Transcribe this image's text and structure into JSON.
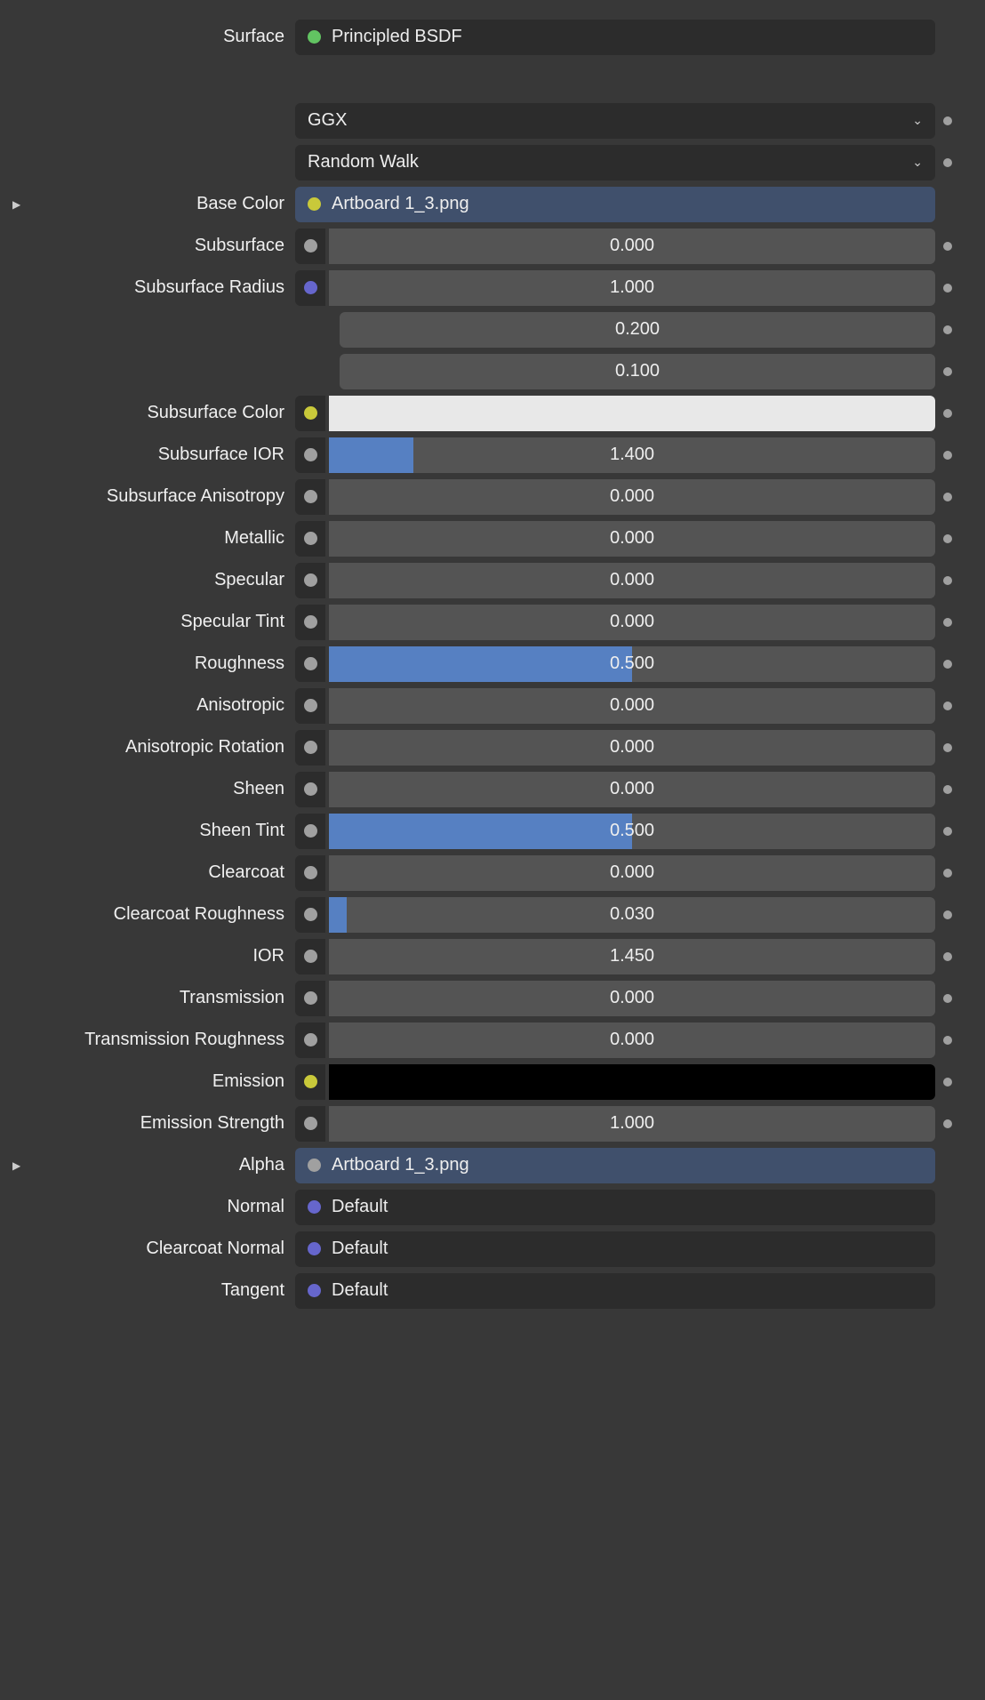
{
  "surface_label": "Surface",
  "surface_value": "Principled BSDF",
  "distribution": "GGX",
  "sss_method": "Random Walk",
  "rows": [
    {
      "label": "Base Color",
      "type": "linked",
      "socket": "yellow",
      "value": "Artboard 1_3.png",
      "expand": true
    },
    {
      "label": "Subsurface",
      "type": "slider",
      "socket": "grey",
      "value": "0.000",
      "fill": 0,
      "anim": true
    },
    {
      "label": "Subsurface Radius",
      "type": "slider",
      "socket": "purple",
      "value": "1.000",
      "fill": 0,
      "anim": true,
      "noconn": false
    },
    {
      "label": "",
      "type": "slider",
      "socket": null,
      "value": "0.200",
      "fill": 0,
      "anim": true,
      "noconn": true
    },
    {
      "label": "",
      "type": "slider",
      "socket": null,
      "value": "0.100",
      "fill": 0,
      "anim": true,
      "noconn": true
    },
    {
      "label": "Subsurface Color",
      "type": "color",
      "socket": "yellow",
      "swatch": "white",
      "anim": true
    },
    {
      "label": "Subsurface IOR",
      "type": "slider",
      "socket": "grey",
      "value": "1.400",
      "fill": 0.14,
      "anim": true
    },
    {
      "label": "Subsurface Anisotropy",
      "type": "slider",
      "socket": "grey",
      "value": "0.000",
      "fill": 0,
      "anim": true
    },
    {
      "label": "Metallic",
      "type": "slider",
      "socket": "grey",
      "value": "0.000",
      "fill": 0,
      "anim": true
    },
    {
      "label": "Specular",
      "type": "slider",
      "socket": "grey",
      "value": "0.000",
      "fill": 0,
      "anim": true
    },
    {
      "label": "Specular Tint",
      "type": "slider",
      "socket": "grey",
      "value": "0.000",
      "fill": 0,
      "anim": true
    },
    {
      "label": "Roughness",
      "type": "slider",
      "socket": "grey",
      "value": "0.500",
      "fill": 0.5,
      "anim": true
    },
    {
      "label": "Anisotropic",
      "type": "slider",
      "socket": "grey",
      "value": "0.000",
      "fill": 0,
      "anim": true
    },
    {
      "label": "Anisotropic Rotation",
      "type": "slider",
      "socket": "grey",
      "value": "0.000",
      "fill": 0,
      "anim": true
    },
    {
      "label": "Sheen",
      "type": "slider",
      "socket": "grey",
      "value": "0.000",
      "fill": 0,
      "anim": true
    },
    {
      "label": "Sheen Tint",
      "type": "slider",
      "socket": "grey",
      "value": "0.500",
      "fill": 0.5,
      "anim": true
    },
    {
      "label": "Clearcoat",
      "type": "slider",
      "socket": "grey",
      "value": "0.000",
      "fill": 0,
      "anim": true
    },
    {
      "label": "Clearcoat Roughness",
      "type": "slider",
      "socket": "grey",
      "value": "0.030",
      "fill": 0.03,
      "anim": true
    },
    {
      "label": "IOR",
      "type": "slider",
      "socket": "grey",
      "value": "1.450",
      "fill": 0,
      "anim": true
    },
    {
      "label": "Transmission",
      "type": "slider",
      "socket": "grey",
      "value": "0.000",
      "fill": 0,
      "anim": true
    },
    {
      "label": "Transmission Roughness",
      "type": "slider",
      "socket": "grey",
      "value": "0.000",
      "fill": 0,
      "anim": true
    },
    {
      "label": "Emission",
      "type": "color",
      "socket": "yellow",
      "swatch": "black",
      "anim": true
    },
    {
      "label": "Emission Strength",
      "type": "slider",
      "socket": "grey",
      "value": "1.000",
      "fill": 0,
      "anim": true
    },
    {
      "label": "Alpha",
      "type": "linked",
      "socket": "grey",
      "value": "Artboard 1_3.png",
      "expand": true
    },
    {
      "label": "Normal",
      "type": "default",
      "socket": "purple",
      "value": "Default"
    },
    {
      "label": "Clearcoat Normal",
      "type": "default",
      "socket": "purple",
      "value": "Default"
    },
    {
      "label": "Tangent",
      "type": "default",
      "socket": "purple",
      "value": "Default"
    }
  ]
}
